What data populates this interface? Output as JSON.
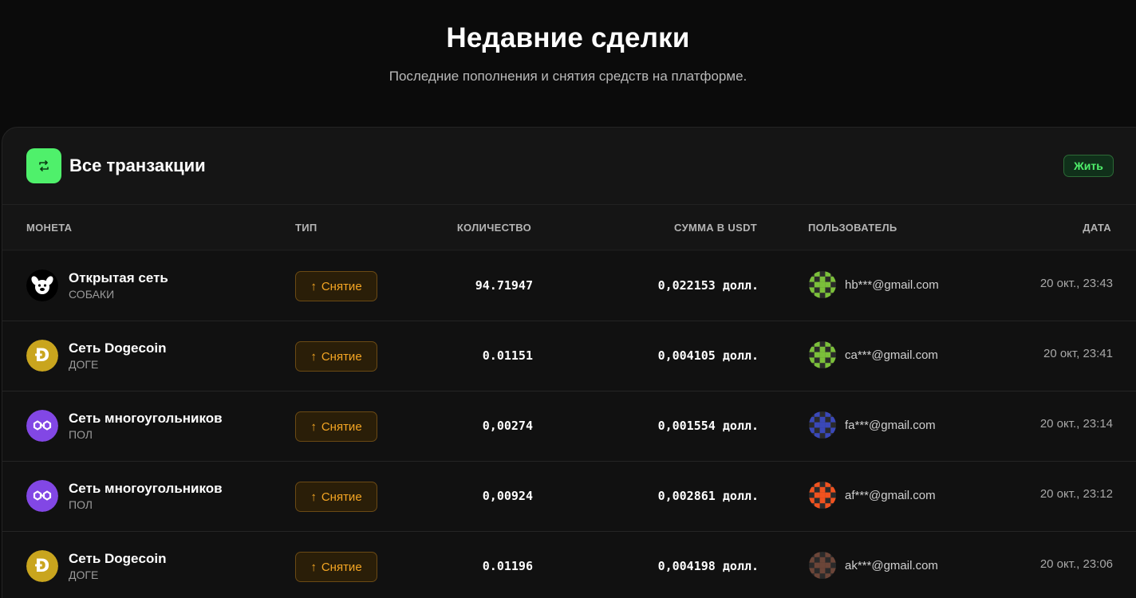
{
  "hero": {
    "title": "Недавние сделки",
    "subtitle": "Последние пополнения и снятия средств на платформе."
  },
  "panel": {
    "title": "Все транзакции",
    "live_label": "Жить",
    "header_icon": "repeat-arrows-icon"
  },
  "columns": {
    "coin": "МОНЕТА",
    "type": "ТИП",
    "quantity": "КОЛИЧЕСТВО",
    "usdt": "СУММА В USDT",
    "user": "ПОЛЬЗОВАТЕЛЬ",
    "date": "ДАТА"
  },
  "colors": {
    "accent_green": "#4ff06b",
    "withdraw_orange": "#f5a623"
  },
  "rows": [
    {
      "coin_name": "Открытая сеть",
      "coin_ticker": "СОБАКИ",
      "coin_icon": "dogs-icon",
      "type": "Снятие",
      "quantity": "94.71947",
      "usdt": "0,022153 долл.",
      "email": "hb***@gmail.com",
      "avatar_color": "#7bbf3a",
      "date": "20 окт., 23:43"
    },
    {
      "coin_name": "Сеть Dogecoin",
      "coin_ticker": "ДОГЕ",
      "coin_icon": "dogecoin-icon",
      "type": "Снятие",
      "quantity": "0.01151",
      "usdt": "0,004105 долл.",
      "email": "ca***@gmail.com",
      "avatar_color": "#7bbf3a",
      "date": "20 окт, 23:41"
    },
    {
      "coin_name": "Сеть многоугольников",
      "coin_ticker": "ПОЛ",
      "coin_icon": "polygon-icon",
      "type": "Снятие",
      "quantity": "0,00274",
      "usdt": "0,001554 долл.",
      "email": "fa***@gmail.com",
      "avatar_color": "#3a48b8",
      "date": "20 окт., 23:14"
    },
    {
      "coin_name": "Сеть многоугольников",
      "coin_ticker": "ПОЛ",
      "coin_icon": "polygon-icon",
      "type": "Снятие",
      "quantity": "0,00924",
      "usdt": "0,002861 долл.",
      "email": "af***@gmail.com",
      "avatar_color": "#f0521f",
      "date": "20 окт., 23:12"
    },
    {
      "coin_name": "Сеть Dogecoin",
      "coin_ticker": "ДОГЕ",
      "coin_icon": "dogecoin-icon",
      "type": "Снятие",
      "quantity": "0.01196",
      "usdt": "0,004198 долл.",
      "email": "ak***@gmail.com",
      "avatar_color": "#6b4538",
      "date": "20 окт., 23:06"
    }
  ]
}
